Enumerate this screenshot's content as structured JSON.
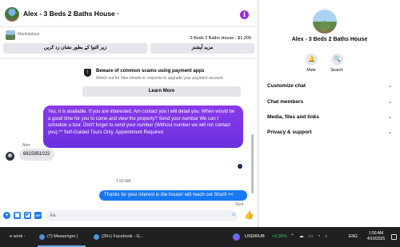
{
  "header": {
    "title": "Alex - 3 Beds 2 Baths House",
    "chevron": "⌄",
    "info_glyph": "i"
  },
  "marketplace": {
    "label": "Marketplace",
    "listing": "3 Beds 2 Baths House - $1,200",
    "btn_left": "زیر التوا کے بطور نشان زد کریں",
    "btn_right": "مزید آپشنز"
  },
  "scam_notice": {
    "icon": "shield-icon",
    "title": "Beware of common scams using payment apps",
    "subtitle": "Watch out for fake emails or requests to upgrade your payment account.",
    "button": "Learn More"
  },
  "messages": {
    "outgoing_long": "Yes, it is available. If you are interested.  Am contact you i will detail you.  When would be a good time for you to come and view the property? Send your numbar  We can I schedule a tour.  Don't forget to send your number (Without number we will not contact you).** Self-Guided Tours Only. Appointment Required",
    "sender_name": "Alex",
    "incoming": "6615951022",
    "timestamp": "1:50 AM",
    "outgoing_short": "Thanks for your interest in the house! will reach out Shortl <<",
    "status": "Sent"
  },
  "composer": {
    "placeholder": "Aa",
    "plus_glyph": "+",
    "pic_glyph": "▣",
    "sticker_glyph": "◪",
    "gif_glyph": "GIF",
    "emoji_glyph": "☺",
    "like_glyph": "👍"
  },
  "panel": {
    "title": "Alex - 3 Beds 2 Baths House",
    "mute_glyph": "🔔",
    "search_glyph": "🔍",
    "mute_label": "Mute",
    "search_label": "Search",
    "chevron": "⌄",
    "rows": [
      "Customize chat",
      "Chat members",
      "Media, files and links",
      "Privacy & support"
    ]
  },
  "taskbar": {
    "items": [
      "e work - Googl...",
      "(7) Messenger | Fac...",
      "(20+) Facebook - G..."
    ],
    "stock_pair": "USD/RUB",
    "stock_change": "+0.35%",
    "tray_icons": "⌃ ☁ ▭ ◔ ♪",
    "lang": "ENG",
    "time": "1:50 AM",
    "date": "4/10/2025"
  },
  "colors": {
    "accent_blue": "#1877f2",
    "accent_purple": "#7a35e6",
    "info_purple": "#9b2ce6",
    "stock_green": "#4ec36a"
  }
}
